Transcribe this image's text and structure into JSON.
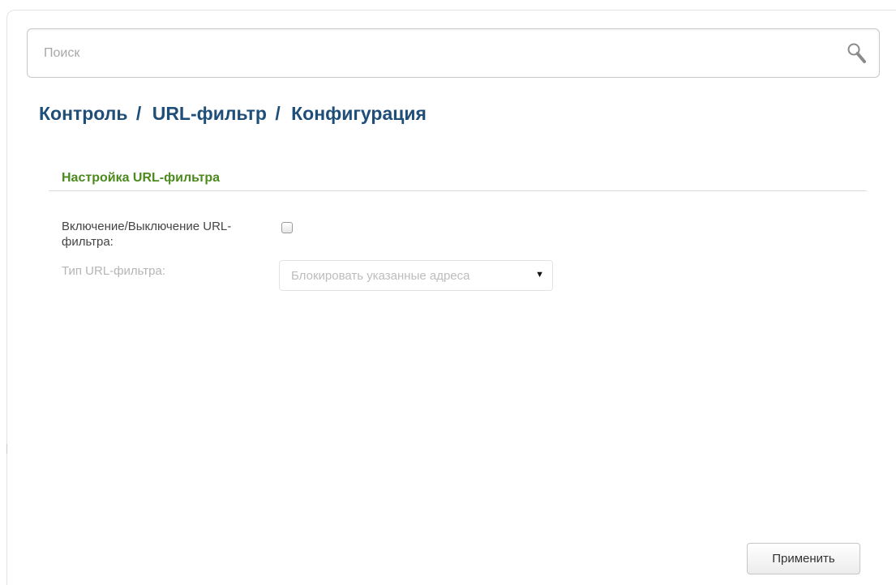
{
  "search": {
    "placeholder": "Поиск",
    "icon": "search-icon"
  },
  "breadcrumb": {
    "items": [
      "Контроль",
      "URL-фильтр",
      "Конфигурация"
    ],
    "separator": "/"
  },
  "section": {
    "title": "Настройка URL-фильтра"
  },
  "form": {
    "enable_label": "Включение/Выключение URL-фильтра:",
    "enable_checked": false,
    "type_label": "Тип URL-фильтра:",
    "type_value": "Блокировать указанные адреса",
    "type_disabled": true
  },
  "actions": {
    "apply_label": "Применить"
  },
  "colors": {
    "breadcrumb": "#1f4e79",
    "section_title": "#4c8a1d",
    "disabled_text": "#b5b5b5"
  }
}
